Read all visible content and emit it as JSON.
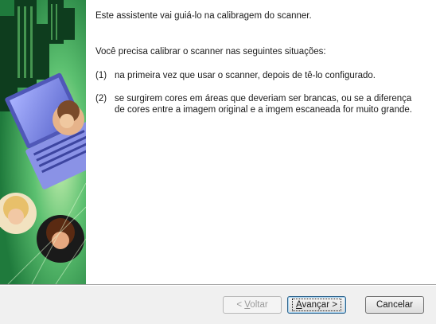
{
  "content": {
    "intro": "Este assistente vai guiá-lo na calibragem do scanner.",
    "lead": "Você precisa calibrar o scanner nas seguintes situações:",
    "items": [
      {
        "number": "(1)",
        "text": "na primeira vez que usar o scanner, depois de tê-lo configurado."
      },
      {
        "number": "(2)",
        "text": "se surgirem cores em áreas que deveriam ser brancas, ou se a diferença de cores entre a imagem original e a imgem escaneada for muito grande."
      }
    ]
  },
  "buttons": {
    "back": {
      "prefix": "< ",
      "accel": "V",
      "rest": "oltar",
      "enabled": false
    },
    "next": {
      "accel": "A",
      "rest": "vançar >"
    },
    "cancel": {
      "label": "Cancelar"
    }
  },
  "colors": {
    "art_green": "#38a858",
    "art_dark": "#0e3d1e",
    "laptop_blue": "#7c86e0",
    "footer_bg": "#f0f0f0"
  },
  "icons": {
    "side_art": "wizard-banner-image"
  }
}
